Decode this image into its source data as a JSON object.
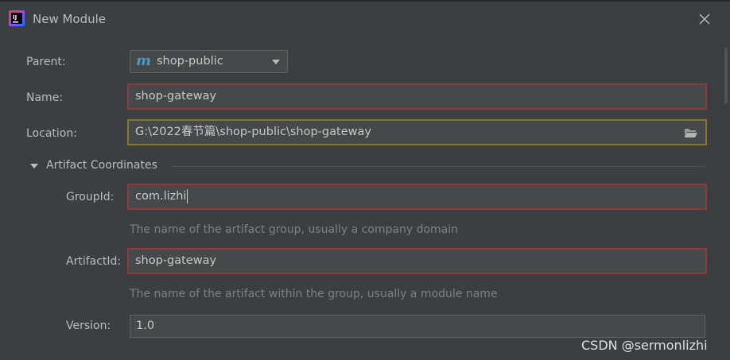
{
  "window": {
    "title": "New Module"
  },
  "form": {
    "parent_label": "Parent:",
    "parent_value": "shop-public",
    "parent_icon": "m",
    "name_label": "Name:",
    "name_value": "shop-gateway",
    "location_label": "Location:",
    "location_value": "G:\\2022春节篇\\shop-public\\shop-gateway"
  },
  "artifact": {
    "section_title": "Artifact Coordinates",
    "group_label": "GroupId:",
    "group_value": "com.lizhi",
    "group_hint": "The name of the artifact group, usually a company domain",
    "artifact_label": "ArtifactId:",
    "artifact_value": "shop-gateway",
    "artifact_hint": "The name of the artifact within the group, usually a module name",
    "version_label": "Version:",
    "version_value": "1.0"
  },
  "watermark": "CSDN @sermonlizhi",
  "colors": {
    "background": "#3c3f41",
    "field_bg": "#45494a",
    "error_border": "#8b3c3c",
    "warning_border": "#8a7330",
    "maven_icon": "#3d9fd6"
  },
  "icons": {
    "app": "intellij-logo-icon",
    "close": "close-icon",
    "parent": "maven-module-icon",
    "dropdown": "chevron-down-icon",
    "folder": "folder-open-icon",
    "section": "triangle-down-icon"
  }
}
